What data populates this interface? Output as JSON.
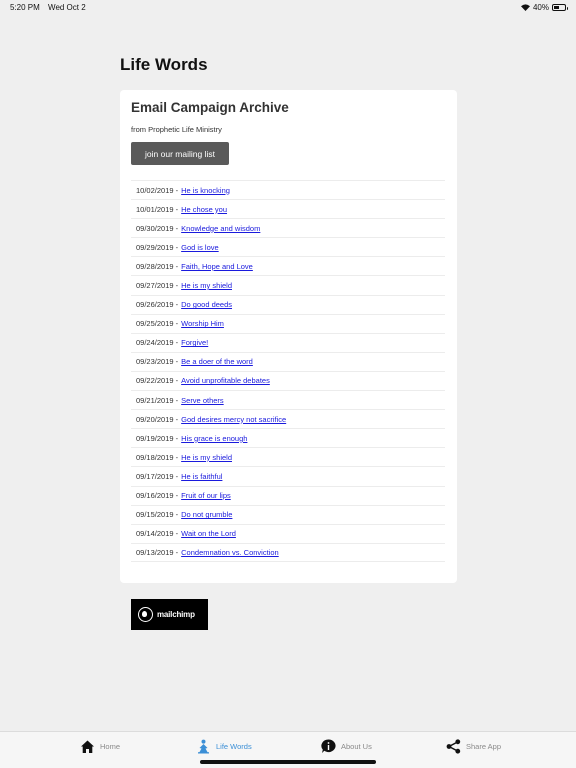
{
  "status_bar": {
    "time": "5:20 PM",
    "date": "Wed Oct 2",
    "battery": "40%",
    "battery_level": 0.4
  },
  "page": {
    "title": "Life Words"
  },
  "archive": {
    "title": "Email Campaign Archive",
    "subtitle": "from Prophetic Life Ministry",
    "button_label": "join our mailing list",
    "items": [
      {
        "date": "10/02/2019",
        "title": "He is knocking"
      },
      {
        "date": "10/01/2019",
        "title": "He chose you"
      },
      {
        "date": "09/30/2019",
        "title": "Knowledge and wisdom"
      },
      {
        "date": "09/29/2019",
        "title": "God is love"
      },
      {
        "date": "09/28/2019",
        "title": "Faith, Hope and Love"
      },
      {
        "date": "09/27/2019",
        "title": "He is my shield"
      },
      {
        "date": "09/26/2019",
        "title": "Do good deeds"
      },
      {
        "date": "09/25/2019",
        "title": "Worship Him"
      },
      {
        "date": "09/24/2019",
        "title": "Forgive!"
      },
      {
        "date": "09/23/2019",
        "title": "Be a doer of the word"
      },
      {
        "date": "09/22/2019",
        "title": "Avoid unprofitable debates"
      },
      {
        "date": "09/21/2019",
        "title": "Serve others"
      },
      {
        "date": "09/20/2019",
        "title": "God desires mercy not sacrifice"
      },
      {
        "date": "09/19/2019",
        "title": "His grace is enough"
      },
      {
        "date": "09/18/2019",
        "title": "He is my shield"
      },
      {
        "date": "09/17/2019",
        "title": "He is faithful"
      },
      {
        "date": "09/16/2019",
        "title": "Fruit of our lips"
      },
      {
        "date": "09/15/2019",
        "title": "Do not grumble"
      },
      {
        "date": "09/14/2019",
        "title": "Wait on the Lord"
      },
      {
        "date": "09/13/2019",
        "title": "Condemnation vs. Conviction"
      }
    ]
  },
  "footer_logo": {
    "text": "mailchimp"
  },
  "tabs": [
    {
      "label": "Home",
      "icon": "home-icon",
      "active": false
    },
    {
      "label": "Life Words",
      "icon": "praying-person-icon",
      "active": true
    },
    {
      "label": "About Us",
      "icon": "info-icon",
      "active": false
    },
    {
      "label": "Share App",
      "icon": "share-icon",
      "active": false
    }
  ],
  "colors": {
    "link": "#1a1add",
    "active_tab": "#3b8fd6",
    "inactive_tab": "#8a8a8a",
    "button": "#5a5a5a"
  }
}
